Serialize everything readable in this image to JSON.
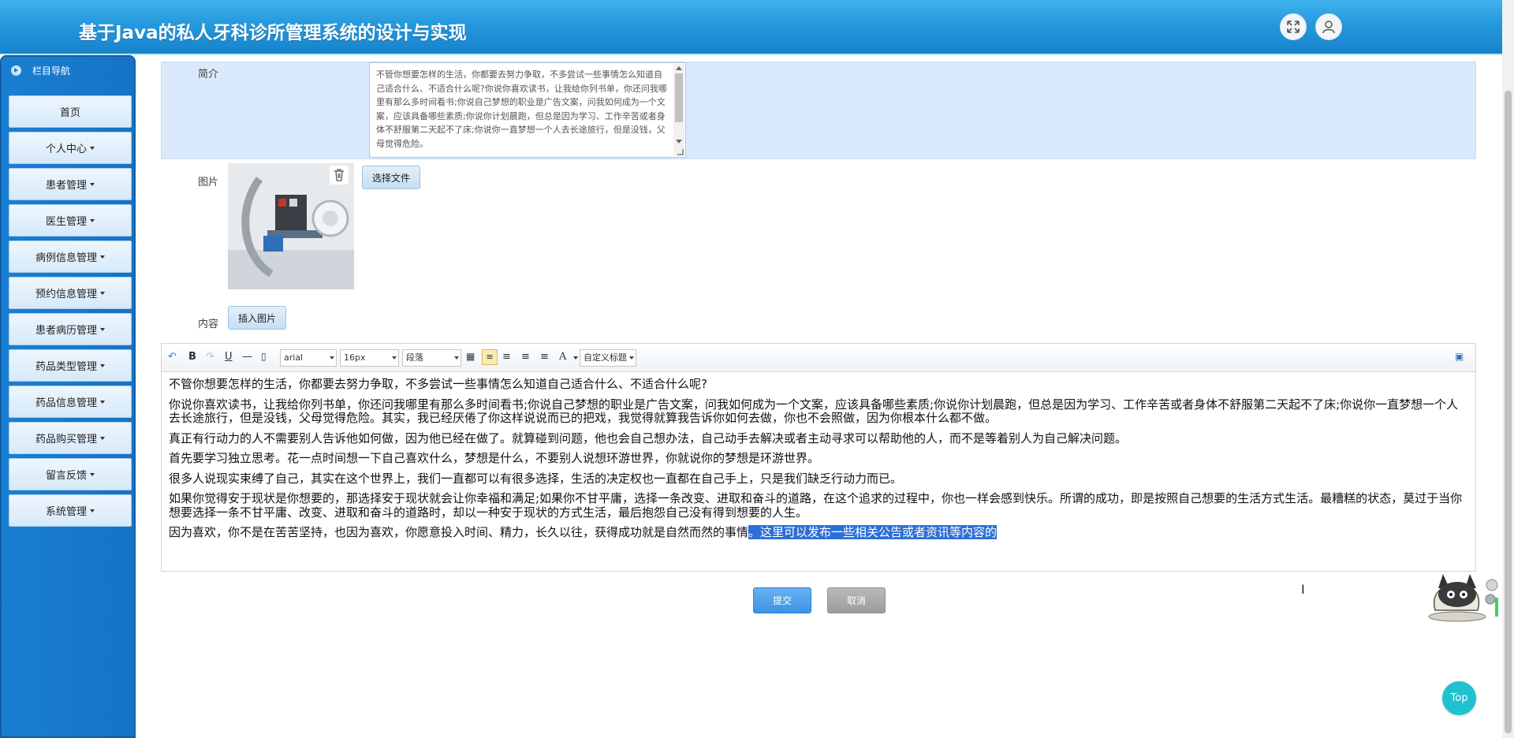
{
  "header": {
    "title": "基于Java的私人牙科诊所管理系统的设计与实现"
  },
  "sidebar": {
    "heading": "栏目导航",
    "items": [
      {
        "label": "首页",
        "dropdown": false
      },
      {
        "label": "个人中心",
        "dropdown": true
      },
      {
        "label": "患者管理",
        "dropdown": true
      },
      {
        "label": "医生管理",
        "dropdown": true
      },
      {
        "label": "病例信息管理",
        "dropdown": true
      },
      {
        "label": "预约信息管理",
        "dropdown": true
      },
      {
        "label": "患者病历管理",
        "dropdown": true
      },
      {
        "label": "药品类型管理",
        "dropdown": true
      },
      {
        "label": "药品信息管理",
        "dropdown": true
      },
      {
        "label": "药品购买管理",
        "dropdown": true
      },
      {
        "label": "留言反馈",
        "dropdown": true
      },
      {
        "label": "系统管理",
        "dropdown": true
      }
    ]
  },
  "form": {
    "intro_label": "简介",
    "intro_text": "不管你想要怎样的生活，你都要去努力争取，不多尝试一些事情怎么知道自己适合什么、不适合什么呢?你说你喜欢读书，让我给你列书单，你还问我哪里有那么多时间看书;你说自己梦想的职业是广告文案，问我如何成为一个文案，应该具备哪些素质;你说你计划晨跑，但总是因为学习、工作辛苦或者身体不舒服第二天起不了床;你说你一直梦想一个人去长途旅行，但是没钱，父母觉得危险。",
    "image_label": "图片",
    "choose_file": "选择文件",
    "content_label": "内容",
    "insert_image": "插入图片",
    "submit": "提交",
    "cancel": "取消"
  },
  "editor": {
    "font": "arial",
    "size": "16px",
    "paragraph": "段落",
    "custom_heading": "自定义标题",
    "paragraphs": [
      "不管你想要怎样的生活，你都要去努力争取，不多尝试一些事情怎么知道自己适合什么、不适合什么呢?",
      "你说你喜欢读书，让我给你列书单，你还问我哪里有那么多时间看书;你说自己梦想的职业是广告文案，问我如何成为一个文案，应该具备哪些素质;你说你计划晨跑，但总是因为学习、工作辛苦或者身体不舒服第二天起不了床;你说你一直梦想一个人去长途旅行，但是没钱，父母觉得危险。其实，我已经厌倦了你这样说说而已的把戏，我觉得就算我告诉你如何去做，你也不会照做，因为你根本什么都不做。",
      "真正有行动力的人不需要别人告诉他如何做，因为他已经在做了。就算碰到问题，他也会自己想办法，自己动手去解决或者主动寻求可以帮助他的人，而不是等着别人为自己解决问题。",
      "首先要学习独立思考。花一点时间想一下自己喜欢什么，梦想是什么，不要别人说想环游世界，你就说你的梦想是环游世界。",
      "很多人说现实束缚了自己，其实在这个世界上，我们一直都可以有很多选择，生活的决定权也一直都在自己手上，只是我们缺乏行动力而已。",
      "如果你觉得安于现状是你想要的，那选择安于现状就会让你幸福和满足;如果你不甘平庸，选择一条改变、进取和奋斗的道路，在这个追求的过程中，你也一样会感到快乐。所谓的成功，即是按照自己想要的生活方式生活。最糟糕的状态，莫过于当你想要选择一条不甘平庸、改变、进取和奋斗的道路时，却以一种安于现状的方式生活，最后抱怨自己没有得到想要的人生。"
    ],
    "last_paragraph": "因为喜欢，你不是在苦苦坚持，也因为喜欢，你愿意投入时间、精力，长久以往，获得成功就是自然而然的事情",
    "selected_text": "。这里可以发布一些相关公告或者资讯等内容的"
  },
  "top_button": "Top"
}
